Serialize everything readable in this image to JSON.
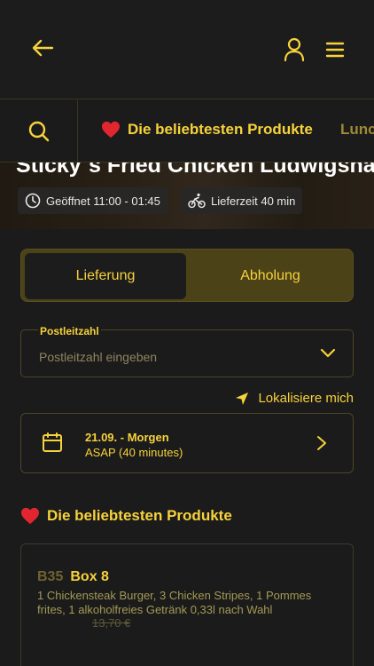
{
  "header": {
    "back_icon": "arrow-left-icon",
    "user_icon": "user-icon",
    "menu_icon": "hamburger-menu-icon",
    "accent": "#f7d23a"
  },
  "categories": {
    "search_icon": "search-icon",
    "items": [
      {
        "label": "Die beliebtesten Produkte",
        "icon": "heart-icon",
        "active": true
      },
      {
        "label": "Lunch",
        "active": false
      }
    ]
  },
  "hero": {
    "title": "Sticky´s Fried Chicken Ludwigshafen",
    "opening": "Geöffnet 11:00 - 01:45",
    "delivery_time": "Lieferzeit 40 min"
  },
  "order_mode": {
    "delivery": "Lieferung",
    "pickup": "Abholung",
    "selected": "delivery"
  },
  "zip": {
    "label": "Postleitzahl",
    "placeholder": "Postleitzahl eingeben",
    "value": ""
  },
  "locate": {
    "label": "Lokalisiere mich"
  },
  "schedule": {
    "date": "21.09. - Morgen",
    "time": "ASAP (40 minutes)"
  },
  "section": {
    "title": "Die beliebtesten Produkte"
  },
  "product": {
    "code": "B35",
    "name": "Box 8",
    "description": "1 Chickensteak Burger, 3 Chicken Stripes, 1 Pommes frites, 1 alkoholfreies Getränk 0,33l nach Wahl",
    "old_price": "13,70 €"
  }
}
